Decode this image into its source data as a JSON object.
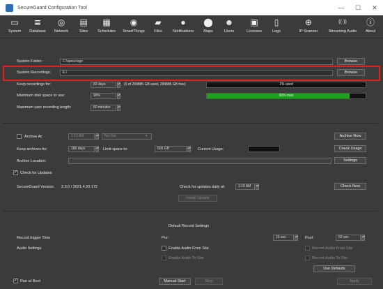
{
  "window": {
    "title": "SecureGuard Configuration Tool",
    "controls": {
      "minimize": "—",
      "maximize": "☐",
      "close": "✕"
    }
  },
  "toolbar": {
    "items": [
      {
        "label": "System",
        "icon": "monitor-icon",
        "glyph": "▭"
      },
      {
        "label": "Database",
        "icon": "database-icon",
        "glyph": "≣"
      },
      {
        "label": "Network",
        "icon": "network-icon",
        "glyph": "◎"
      },
      {
        "label": "Sites",
        "icon": "sites-icon",
        "glyph": "▤"
      },
      {
        "label": "Schedules",
        "icon": "calendar-icon",
        "glyph": "▦"
      },
      {
        "label": "SmartThings",
        "icon": "smartthings-icon",
        "glyph": "◉"
      },
      {
        "label": "Files",
        "icon": "folder-icon",
        "glyph": "▰"
      },
      {
        "label": "Notifications",
        "icon": "bell-icon",
        "glyph": "●"
      },
      {
        "label": "Maps",
        "icon": "map-pin-icon",
        "glyph": "⬤"
      },
      {
        "label": "Users",
        "icon": "users-icon",
        "glyph": "☻"
      },
      {
        "label": "Licenses",
        "icon": "license-icon",
        "glyph": "▣"
      },
      {
        "label": "Logs",
        "icon": "logs-icon",
        "glyph": "▯"
      },
      {
        "label": "IP Scanner",
        "icon": "scanner-icon",
        "glyph": "⊕"
      },
      {
        "label": "Streaming Audio",
        "icon": "audio-icon",
        "glyph": "((·))"
      },
      {
        "label": "About",
        "icon": "info-icon",
        "glyph": "ⓘ"
      }
    ]
  },
  "storage": {
    "system_folder_label": "System Folder:",
    "system_folder_value": "C:\\specs\\sgo",
    "system_recordings_label": "System Recordings:",
    "system_recordings_value": "E:\\",
    "browse_label": "Browse",
    "keep_recordings_label": "Keep recordings for:",
    "keep_recordings_value": "60 days",
    "usage_info": "(0 of 299885 GB used, 299885 GB free)",
    "usage_bar_text": "1% used",
    "usage_fraction": 0.01,
    "max_disk_label": "Maximum disk space to use:",
    "max_disk_value": "90%",
    "max_disk_bar_text": "90% max",
    "max_disk_fraction": 0.9,
    "max_user_rec_label": "Maximum user recording length:",
    "max_user_rec_value": "60 minutes"
  },
  "archive": {
    "archive_at_label": "Archive At:",
    "archive_time": "1:12 AM",
    "archive_mode": "Not Set",
    "archive_now": "Archive Now",
    "keep_archives_label": "Keep archives for:",
    "keep_archives_value": "180 days",
    "limit_label": "Limit space to:",
    "limit_value": "500 GB",
    "current_usage_label": "Current Usage:",
    "check_usage": "Check Usage",
    "location_label": "Archive Location:",
    "settings": "Settings"
  },
  "updates": {
    "check_label": "Check for Updates",
    "check_checked": "✓",
    "version_label": "SecureGuard Version:",
    "version_value": "2.3.0 / 2021.4.20.172",
    "daily_label": "Check for updates daily at:",
    "daily_value": "1:10 AM",
    "check_now": "Check Now",
    "install": "Install Update"
  },
  "record_defaults": {
    "heading": "Default Record Settings",
    "trigger_label": "Record trigger Time",
    "pre_label": "Pre:",
    "pre_value": "15 sec",
    "post_label": "Post:",
    "post_value": "60 sec",
    "audio_label": "Audio Settings",
    "enable_audio": "Enable Audio From Site",
    "enable_audio_to": "Enable Audio To Site",
    "record_from": "Record Audio From Site",
    "record_to": "Record Audio To Site",
    "use_defaults": "Use Defaults"
  },
  "footer": {
    "run_at_boot": "Run at Boot",
    "run_checked": "✓",
    "manual_start": "Manual Start",
    "stop": "Stop",
    "apply": "Apply"
  },
  "colors": {
    "highlight": "#e21f1f",
    "usage_green": "#1fa01f",
    "background": "#3b3b3b"
  }
}
